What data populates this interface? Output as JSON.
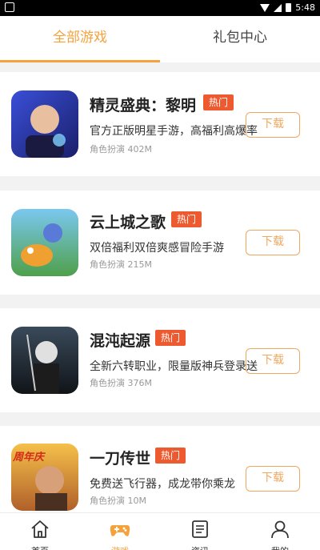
{
  "status_bar": {
    "time": "5:48"
  },
  "tabs": [
    {
      "label": "全部游戏",
      "active": true
    },
    {
      "label": "礼包中心",
      "active": false
    }
  ],
  "colors": {
    "accent": "#f5a23d",
    "hot": "#ee5a30",
    "button": "#f0a860"
  },
  "games": [
    {
      "title": "精灵盛典：黎明",
      "badge": "热门",
      "desc": "官方正版明星手游，高福利高爆率",
      "category": "角色扮演",
      "size": "402M",
      "button": "下载"
    },
    {
      "title": "云上城之歌",
      "badge": "热门",
      "desc": "双倍福利双倍爽感冒险手游",
      "category": "角色扮演",
      "size": "215M",
      "button": "下载"
    },
    {
      "title": "混沌起源",
      "badge": "热门",
      "desc": "全新六转职业，限量版神兵登录送",
      "category": "角色扮演",
      "size": "376M",
      "button": "下载"
    },
    {
      "title": "一刀传世",
      "badge": "热门",
      "desc": "免费送飞行器，成龙带你乘龙",
      "category": "角色扮演",
      "size": "10M",
      "button": "下载",
      "icon_caption": "周年庆"
    }
  ],
  "bottom_nav": [
    {
      "label": "首页",
      "icon": "home-icon",
      "active": false
    },
    {
      "label": "游戏",
      "icon": "gamepad-icon",
      "active": true
    },
    {
      "label": "资讯",
      "icon": "news-icon",
      "active": false
    },
    {
      "label": "我的",
      "icon": "profile-icon",
      "active": false
    }
  ]
}
